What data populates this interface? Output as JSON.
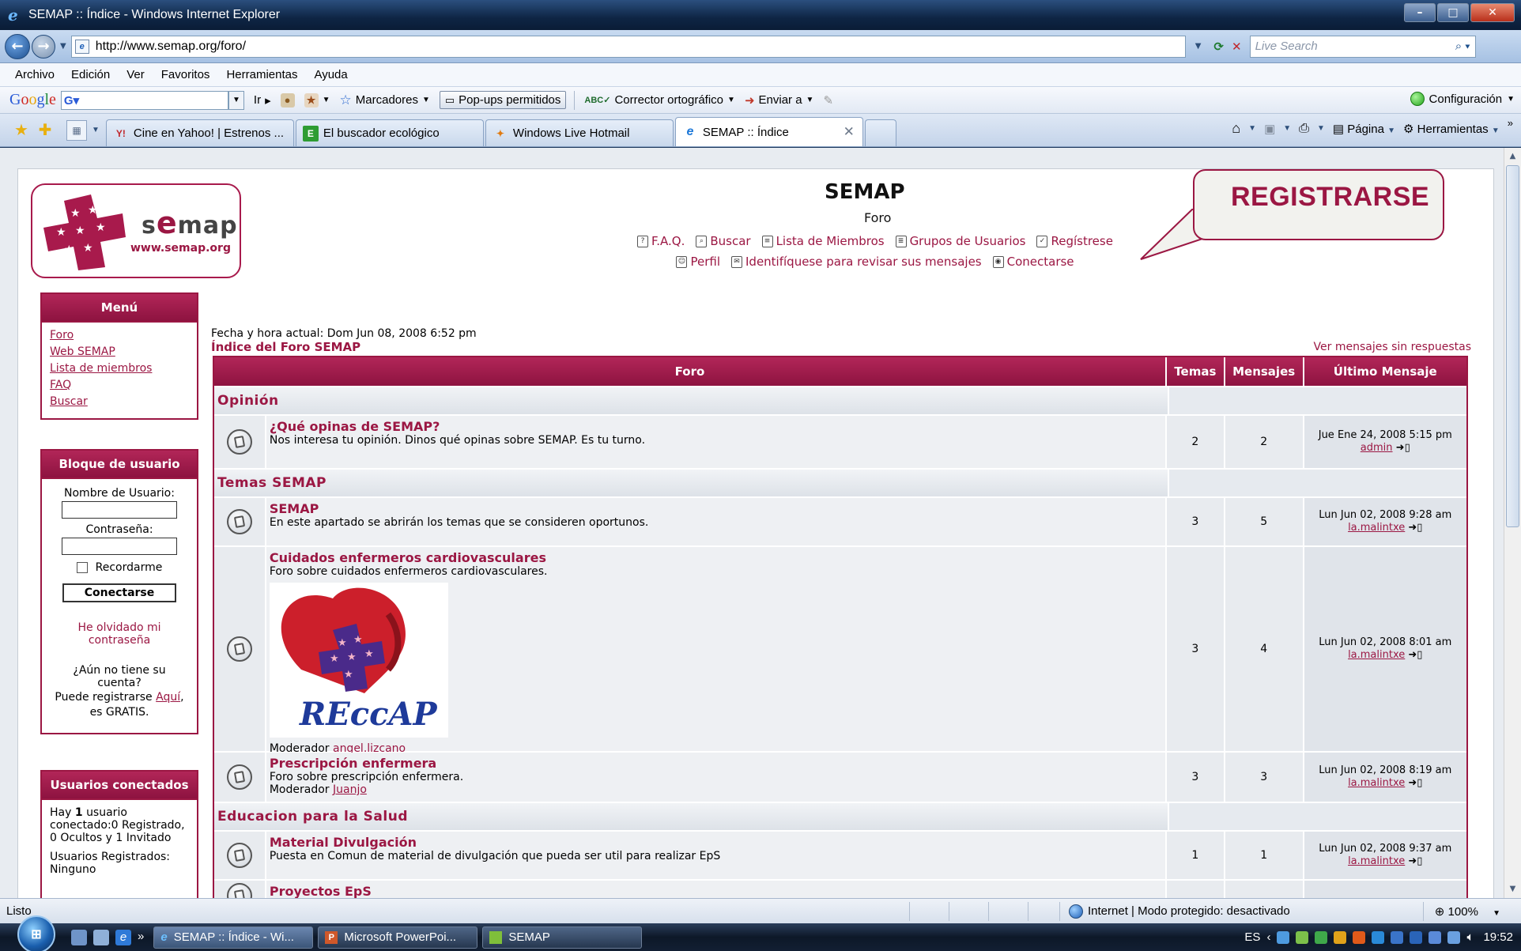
{
  "window": {
    "title": "SEMAP :: Índice - Windows Internet Explorer"
  },
  "address": {
    "url": "http://www.semap.org/foro/",
    "search_placeholder": "Live Search"
  },
  "menu": [
    "Archivo",
    "Edición",
    "Ver",
    "Favoritos",
    "Herramientas",
    "Ayuda"
  ],
  "google_bar": {
    "logo": "Google",
    "go": "Ir",
    "bookmarks": "Marcadores",
    "popups": "Pop-ups permitidos",
    "spell": "Corrector ortográfico",
    "send": "Enviar a",
    "settings": "Configuración"
  },
  "tabs": [
    {
      "label": "Cine en Yahoo! | Estrenos ...",
      "icon": "yahoo-icon"
    },
    {
      "label": "El buscador ecológico",
      "icon": "eco-search-icon"
    },
    {
      "label": "Windows Live Hotmail",
      "icon": "hotmail-icon"
    },
    {
      "label": "SEMAP :: Índice",
      "icon": "ie-page-icon",
      "active": true
    }
  ],
  "commandbar": {
    "page": "Página",
    "tools": "Herramientas"
  },
  "site": {
    "logo_text": "semap",
    "logo_url": "www.semap.org",
    "title": "SEMAP",
    "subtitle": "Foro",
    "links_row1": [
      "F.A.Q.",
      "Buscar",
      "Lista de Miembros",
      "Grupos de Usuarios",
      "Regístrese"
    ],
    "links_row2": [
      "Perfil",
      "Identifíquese para revisar sus mensajes",
      "Conectarse"
    ],
    "callout": "REGISTRARSE"
  },
  "sidebar": {
    "menu_title": "Menú",
    "menu_items": [
      "Foro",
      "Web SEMAP",
      "Lista de miembros",
      "FAQ",
      "Buscar"
    ],
    "user_block": {
      "title": "Bloque de usuario",
      "username_label": "Nombre de Usuario:",
      "password_label": "Contraseña:",
      "remember": "Recordarme",
      "login_button": "Conectarse",
      "forgot": "He olvidado mi contraseña",
      "no_account": "¿Aún no tiene su cuenta?",
      "register_prefix": "Puede registrarse",
      "register_link": "Aquí",
      "register_suffix": ", es GRATIS."
    },
    "online": {
      "title": "Usuarios conectados",
      "line1_prefix": "Hay",
      "line1_count": "1",
      "line1_rest": "usuario conectado:0 Registrado, 0 Ocultos y 1 Invitado",
      "line2": "Usuarios Registrados: Ninguno"
    }
  },
  "main": {
    "datetime": "Fecha y hora actual: Dom Jun 08, 2008 6:52 pm",
    "index_link": "Índice del Foro SEMAP",
    "unanswered": "Ver mensajes sin respuestas",
    "headers": {
      "forum": "Foro",
      "topics": "Temas",
      "posts": "Mensajes",
      "last": "Último Mensaje"
    },
    "categories": [
      {
        "name": "Opinión",
        "forums": [
          {
            "title": "¿Qué opinas de SEMAP?",
            "desc": "Nos interesa tu opinión. Dinos qué opinas sobre SEMAP. Es tu turno.",
            "moderator": "",
            "topics": "2",
            "posts": "2",
            "last_date": "Jue Ene 24, 2008 5:15 pm",
            "last_user": "admin"
          }
        ]
      },
      {
        "name": "Temas SEMAP",
        "forums": [
          {
            "title": "SEMAP",
            "desc": "En este apartado se abrirán los temas que se consideren oportunos.",
            "moderator": "",
            "topics": "3",
            "posts": "5",
            "last_date": "Lun Jun 02, 2008 9:28 am",
            "last_user": "la.malintxe"
          },
          {
            "title": "Cuidados enfermeros cardiovasculares",
            "desc": "Foro sobre cuidados enfermeros cardiovasculares.",
            "image_text": "REccAP",
            "moderator_label": "Moderador",
            "moderator": "angel.lizcano",
            "topics": "3",
            "posts": "4",
            "last_date": "Lun Jun 02, 2008 8:01 am",
            "last_user": "la.malintxe"
          },
          {
            "title": "Prescripción enfermera",
            "desc": "Foro sobre prescripción enfermera.",
            "moderator_label": "Moderador",
            "moderator": "Juanjo",
            "topics": "3",
            "posts": "3",
            "last_date": "Lun Jun 02, 2008 8:19 am",
            "last_user": "la.malintxe"
          }
        ]
      },
      {
        "name": "Educacion para la Salud",
        "forums": [
          {
            "title": "Material Divulgación",
            "desc": "Puesta en Comun de material de divulgación que pueda ser util para realizar EpS",
            "moderator": "",
            "topics": "1",
            "posts": "1",
            "last_date": "Lun Jun 02, 2008 9:37 am",
            "last_user": "la.malintxe"
          },
          {
            "title": "Proyectos EpS"
          }
        ]
      }
    ]
  },
  "status": {
    "left": "Listo",
    "zone": "Internet | Modo protegido: desactivado",
    "zoom": "100%"
  },
  "taskbar": {
    "tasks": [
      "SEMAP :: Índice - Wi...",
      "Microsoft PowerPoi...",
      "SEMAP"
    ],
    "lang": "ES",
    "clock": "19:52"
  },
  "colors": {
    "brand": "#9b1743",
    "header_bg": "#8d1340"
  }
}
